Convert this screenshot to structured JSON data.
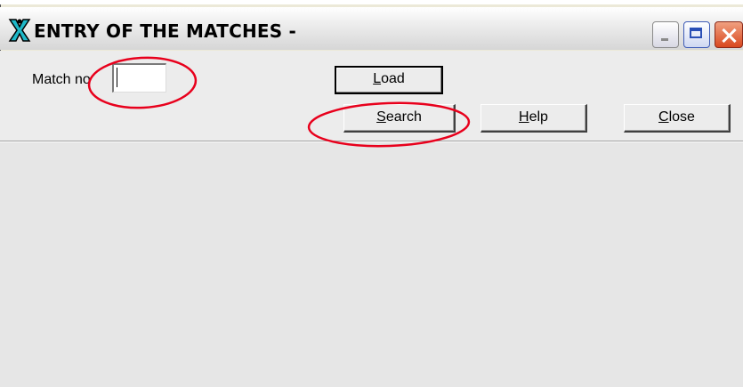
{
  "window": {
    "title": "ENTRY OF THE MATCHES -",
    "icon": "app-figure-icon"
  },
  "form": {
    "match_no_label": "Match no",
    "match_no_value": ""
  },
  "buttons": {
    "load": "Load",
    "search": "Search",
    "help": "Help",
    "close": "Close"
  },
  "colors": {
    "annotation": "#e8001c"
  }
}
